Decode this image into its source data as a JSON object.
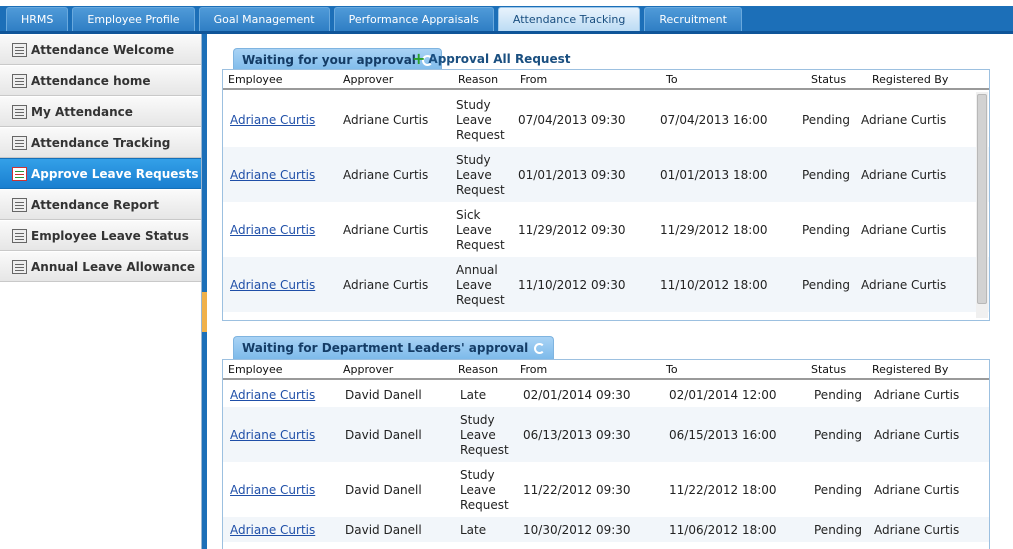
{
  "top_tabs": [
    {
      "label": "HRMS"
    },
    {
      "label": "Employee Profile"
    },
    {
      "label": "Goal Management"
    },
    {
      "label": "Performance Appraisals"
    },
    {
      "label": "Attendance Tracking",
      "active": true
    },
    {
      "label": "Recruitment"
    }
  ],
  "sidebar": {
    "items": [
      {
        "label": "Attendance Welcome",
        "icon": "grid-icon"
      },
      {
        "label": "Attendance home",
        "icon": "grid-icon"
      },
      {
        "label": "My Attendance",
        "icon": "people-icon"
      },
      {
        "label": "Attendance Tracking",
        "icon": "chart-icon"
      },
      {
        "label": "Approve Leave Requests",
        "icon": "checklist-icon",
        "active": true
      },
      {
        "label": "Attendance Report",
        "icon": "chart-icon"
      },
      {
        "label": "Employee Leave Status",
        "icon": "grid-icon"
      },
      {
        "label": "Annual Leave Allowance",
        "icon": "edit-icon"
      }
    ]
  },
  "colors": {
    "accent": "#1c6fb8",
    "active_sidebar": "#1a7fd0",
    "link": "#1f4fa8",
    "approve_plus": "#2aa02a"
  },
  "approval_panel": {
    "title": "Waiting for your approval",
    "approve_all_label": "Approval All Request",
    "columns": [
      "Employee",
      "Approver",
      "Reason",
      "From",
      "To",
      "Status",
      "Registered By"
    ],
    "rows": [
      {
        "employee": "Adriane Curtis",
        "approver": "Adriane Curtis",
        "reason": [
          "Study",
          "Leave",
          "Request"
        ],
        "from": "07/04/2013 09:30",
        "to": "07/04/2013 16:00",
        "status": "Pending",
        "registered_by": "Adriane Curtis"
      },
      {
        "employee": "Adriane Curtis",
        "approver": "Adriane Curtis",
        "reason": [
          "Study",
          "Leave",
          "Request"
        ],
        "from": "01/01/2013 09:30",
        "to": "01/01/2013 18:00",
        "status": "Pending",
        "registered_by": "Adriane Curtis"
      },
      {
        "employee": "Adriane Curtis",
        "approver": "Adriane Curtis",
        "reason": [
          "Sick",
          "Leave",
          "Request"
        ],
        "from": "11/29/2012 09:30",
        "to": "11/29/2012 18:00",
        "status": "Pending",
        "registered_by": "Adriane Curtis"
      },
      {
        "employee": "Adriane Curtis",
        "approver": "Adriane Curtis",
        "reason": [
          "Annual",
          "Leave",
          "Request"
        ],
        "from": "11/10/2012 09:30",
        "to": "11/10/2012 18:00",
        "status": "Pending",
        "registered_by": "Adriane Curtis"
      }
    ]
  },
  "dept_panel": {
    "title": "Waiting for Department Leaders' approval",
    "columns": [
      "Employee",
      "Approver",
      "Reason",
      "From",
      "To",
      "Status",
      "Registered By"
    ],
    "rows": [
      {
        "employee": "Adriane Curtis",
        "approver": "David Danell",
        "reason": [
          "Late"
        ],
        "from": "02/01/2014 09:30",
        "to": "02/01/2014 12:00",
        "status": "Pending",
        "registered_by": "Adriane Curtis"
      },
      {
        "employee": "Adriane Curtis",
        "approver": "David Danell",
        "reason": [
          "Study",
          "Leave",
          "Request"
        ],
        "from": "06/13/2013 09:30",
        "to": "06/15/2013 16:00",
        "status": "Pending",
        "registered_by": "Adriane Curtis"
      },
      {
        "employee": "Adriane Curtis",
        "approver": "David Danell",
        "reason": [
          "Study",
          "Leave",
          "Request"
        ],
        "from": "11/22/2012 09:30",
        "to": "11/22/2012 18:00",
        "status": "Pending",
        "registered_by": "Adriane Curtis"
      },
      {
        "employee": "Adriane Curtis",
        "approver": "David Danell",
        "reason": [
          "Late"
        ],
        "from": "10/30/2012 09:30",
        "to": "11/06/2012 18:00",
        "status": "Pending",
        "registered_by": "Adriane Curtis"
      }
    ]
  }
}
